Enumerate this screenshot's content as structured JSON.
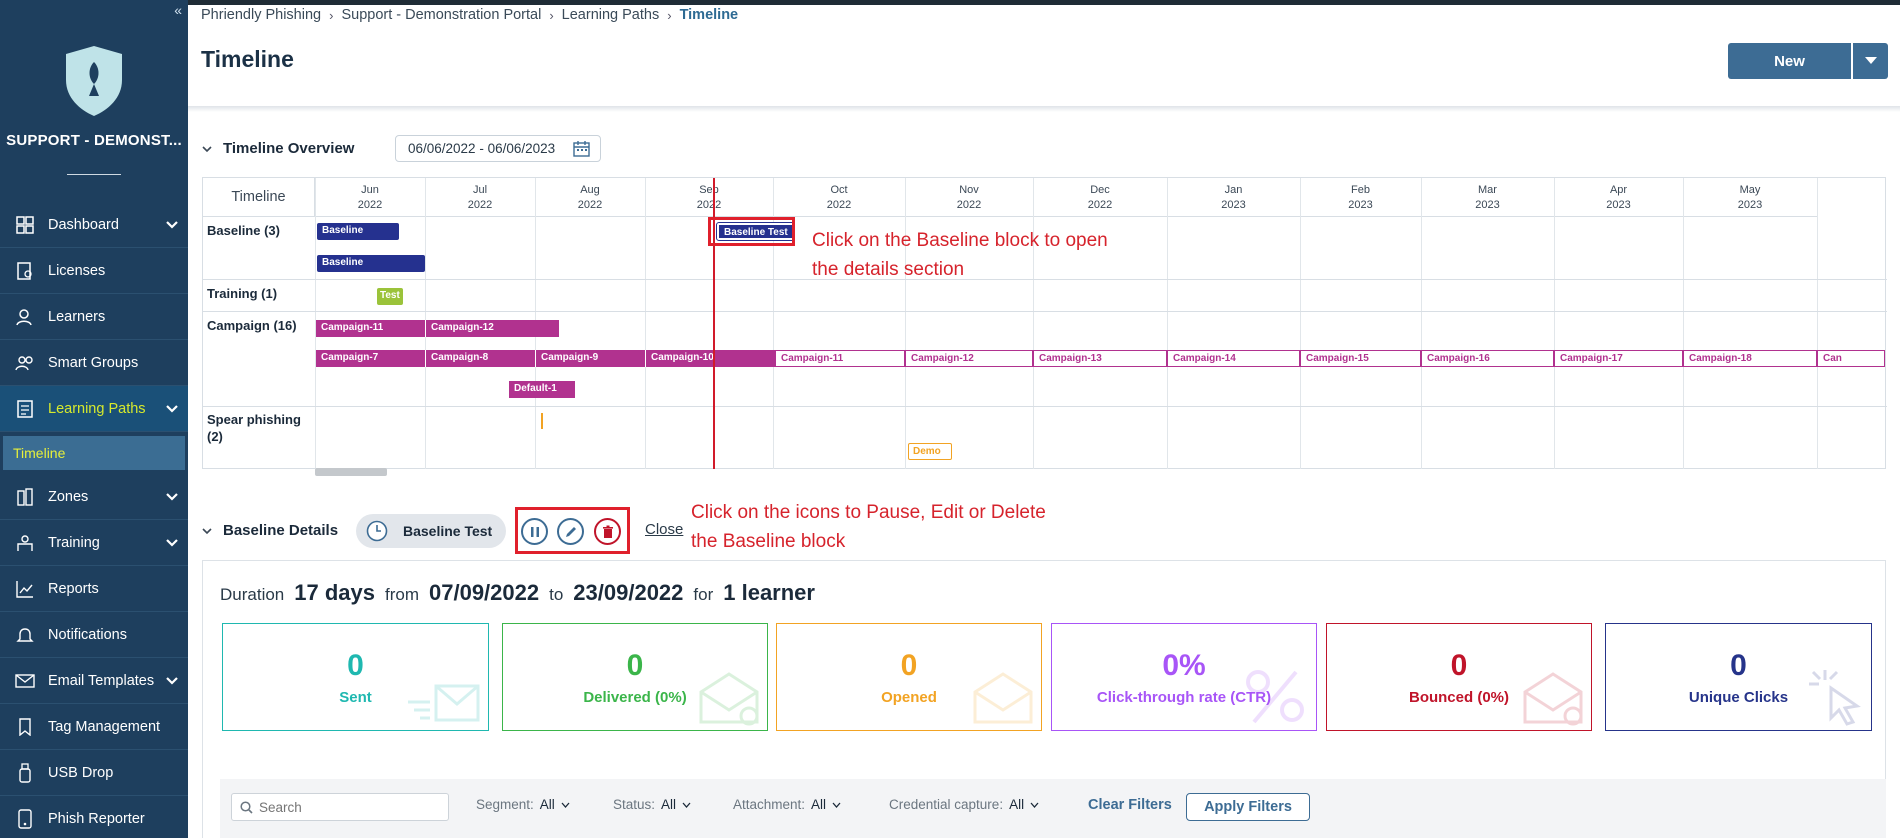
{
  "sidebar": {
    "org_name": "SUPPORT - DEMONST...",
    "items": [
      {
        "label": "Dashboard",
        "icon": "dashboard-icon"
      },
      {
        "label": "Licenses",
        "icon": "license-icon"
      },
      {
        "label": "Learners",
        "icon": "learners-icon"
      },
      {
        "label": "Smart Groups",
        "icon": "smart-groups-icon"
      },
      {
        "label": "Learning Paths",
        "icon": "learning-paths-icon"
      },
      {
        "label": "Timeline"
      },
      {
        "label": "Zones",
        "icon": "zones-icon"
      },
      {
        "label": "Training",
        "icon": "training-icon"
      },
      {
        "label": "Reports",
        "icon": "reports-icon"
      },
      {
        "label": "Notifications",
        "icon": "bell-icon"
      },
      {
        "label": "Email Templates",
        "icon": "email-icon"
      },
      {
        "label": "Tag Management",
        "icon": "bookmark-icon"
      },
      {
        "label": "USB Drop",
        "icon": "usb-icon"
      },
      {
        "label": "Phish Reporter",
        "icon": "phone-icon"
      }
    ]
  },
  "breadcrumb": [
    "Phriendly Phishing",
    "Support - Demonstration Portal",
    "Learning Paths",
    "Timeline"
  ],
  "page_title": "Timeline",
  "new_button": "New",
  "timeline": {
    "section_title": "Timeline Overview",
    "date_range": "06/06/2022 - 06/06/2023",
    "column_label": "Timeline",
    "months": [
      {
        "m": "Jun",
        "y": "2022"
      },
      {
        "m": "Jul",
        "y": "2022"
      },
      {
        "m": "Aug",
        "y": "2022"
      },
      {
        "m": "Sep",
        "y": "2022"
      },
      {
        "m": "Oct",
        "y": "2022"
      },
      {
        "m": "Nov",
        "y": "2022"
      },
      {
        "m": "Dec",
        "y": "2022"
      },
      {
        "m": "Jan",
        "y": "2023"
      },
      {
        "m": "Feb",
        "y": "2023"
      },
      {
        "m": "Mar",
        "y": "2023"
      },
      {
        "m": "Apr",
        "y": "2023"
      },
      {
        "m": "May",
        "y": "2023"
      }
    ],
    "rows": {
      "baseline": "Baseline (3)",
      "training": "Training (1)",
      "campaign": "Campaign (16)",
      "spear": "Spear phishing (2)"
    },
    "bars": {
      "baseline_1": "Baseline",
      "baseline_2": "Baseline",
      "baseline_test": "Baseline Test",
      "training_test": "Test",
      "c11a": "Campaign-11",
      "c12a": "Campaign-12",
      "c7": "Campaign-7",
      "c8": "Campaign-8",
      "c9": "Campaign-9",
      "c10": "Campaign-10",
      "c11": "Campaign-11",
      "c12": "Campaign-12",
      "c13": "Campaign-13",
      "c14": "Campaign-14",
      "c15": "Campaign-15",
      "c16": "Campaign-16",
      "c17": "Campaign-17",
      "c18": "Campaign-18",
      "c19": "Can",
      "default": "Default-1",
      "demo": "Demo"
    },
    "annotation_1": "Click on the Baseline block to open the details section"
  },
  "details": {
    "section_title": "Baseline Details",
    "pill_label": "Baseline Test",
    "close_label": "Close",
    "annotation_2": "Click on the icons to Pause, Edit or Delete the Baseline block",
    "duration": {
      "duration_label": "Duration",
      "duration_value": "17 days",
      "from_label": "from",
      "from_value": "07/09/2022",
      "to_label": "to",
      "to_value": "23/09/2022",
      "for_label": "for",
      "for_value": "1 learner"
    },
    "stats": [
      {
        "value": "0",
        "label": "Sent",
        "color": "#1fb8b0"
      },
      {
        "value": "0",
        "label": "Delivered (0%)",
        "color": "#3bb54a"
      },
      {
        "value": "0",
        "label": "Opened",
        "color": "#f2a323"
      },
      {
        "value": "0%",
        "label": "Click-through rate (CTR)",
        "color": "#a855f7"
      },
      {
        "value": "0",
        "label": "Bounced (0%)",
        "color": "#c0142a"
      },
      {
        "value": "0",
        "label": "Unique Clicks",
        "color": "#26348a"
      }
    ]
  },
  "filters": {
    "search_placeholder": "Search",
    "segment_label": "Segment:",
    "segment_value": "All",
    "status_label": "Status:",
    "status_value": "All",
    "attachment_label": "Attachment:",
    "attachment_value": "All",
    "credential_label": "Credential capture:",
    "credential_value": "All",
    "clear_label": "Clear Filters",
    "apply_label": "Apply Filters"
  }
}
